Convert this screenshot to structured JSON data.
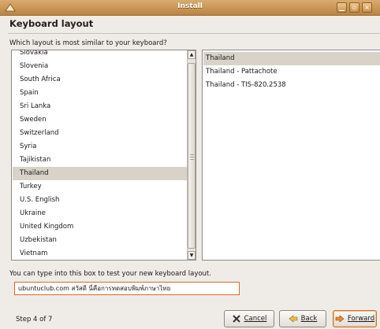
{
  "window": {
    "title": "Install"
  },
  "page": {
    "heading": "Keyboard layout",
    "question": "Which layout is most similar to your keyboard?",
    "step": "Step 4 of 7"
  },
  "layouts": [
    "Slovakia",
    "Slovenia",
    "South Africa",
    "Spain",
    "Sri Lanka",
    "Sweden",
    "Switzerland",
    "Syria",
    "Tajikistan",
    "Thailand",
    "Turkey",
    "U.S. English",
    "Ukraine",
    "United Kingdom",
    "Uzbekistan",
    "Vietnam"
  ],
  "selected_layout": "Thailand",
  "variants": [
    "Thailand",
    "Thailand - Pattachote",
    "Thailand - TIS-820.2538"
  ],
  "selected_variant": "Thailand",
  "test": {
    "label": "You can type into this box to test your new keyboard layout.",
    "value": "ubuntuclub.com สวัสดี นี่คือการทดสอบพิมพ์ภาษาไทย"
  },
  "buttons": {
    "cancel": "Cancel",
    "back": "Back",
    "forward": "Forward"
  },
  "colors": {
    "titlebar": "#c58f4e",
    "selection": "#d8d2c8",
    "focus": "#d96a2a"
  }
}
